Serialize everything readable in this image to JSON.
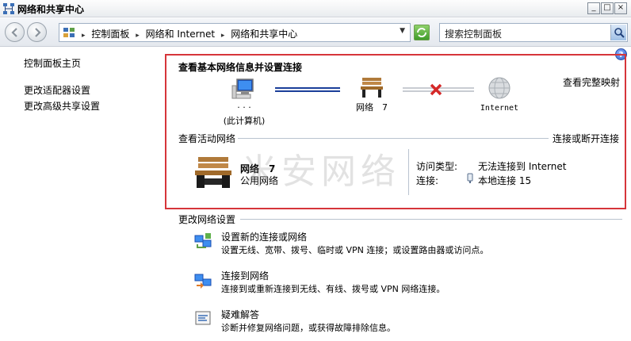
{
  "window": {
    "title": "网络和共享中心",
    "icon": "network-center-icon",
    "controls": [
      "_",
      "□",
      "×"
    ]
  },
  "address": {
    "crumbs": [
      "控制面板",
      "网络和 Internet",
      "网络和共享中心"
    ],
    "search_placeholder": "搜索控制面板"
  },
  "sidebar": {
    "items": [
      {
        "label": "控制面板主页"
      },
      {
        "label": "更改适配器设置"
      },
      {
        "label": "更改高级共享设置"
      }
    ]
  },
  "basic": {
    "title": "查看基本网络信息并设置连接",
    "view_full_map": "查看完整映射",
    "computer_dots": "· · ·",
    "computer_label": "(此计算机)",
    "network_label": "网络　7",
    "internet_label": "Internet"
  },
  "active": {
    "title": "查看活动网络",
    "connect_link": "连接或断开连接",
    "network_name": "网络　7",
    "network_type": "公用网络",
    "access_type_label": "访问类型:",
    "access_type_value": "无法连接到 Internet",
    "connection_label": "连接:",
    "connection_value": "本地连接 15"
  },
  "watermark": "米安网络",
  "change": {
    "title": "更改网络设置",
    "tasks": [
      {
        "title": "设置新的连接或网络",
        "desc": "设置无线、宽带、拨号、临时或 VPN 连接；或设置路由器或访问点。",
        "icon": "new-connection-icon"
      },
      {
        "title": "连接到网络",
        "desc": "连接到或重新连接到无线、有线、拨号或 VPN 网络连接。",
        "icon": "connect-network-icon"
      },
      {
        "title": "疑难解答",
        "desc": "诊断并修复网络问题，或获得故障排除信息。",
        "icon": "troubleshoot-icon"
      }
    ]
  },
  "colors": {
    "highlight_border": "#d6353a",
    "link_blue": "#1a3d8f"
  }
}
